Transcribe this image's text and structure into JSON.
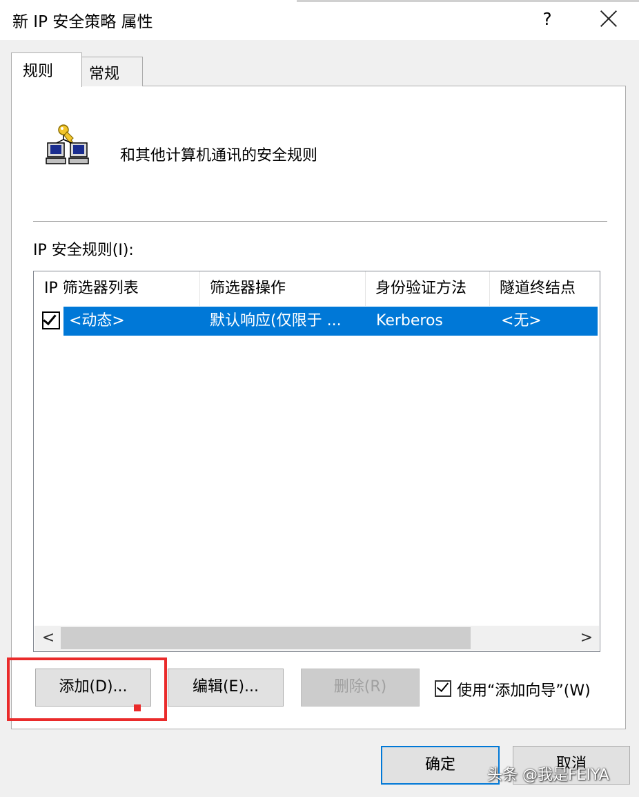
{
  "window": {
    "title": "新 IP 安全策略 属性",
    "help_glyph": "?",
    "close_icon": "close-icon"
  },
  "tabs": [
    {
      "label": "规则",
      "selected": true
    },
    {
      "label": "常规",
      "selected": false
    }
  ],
  "header": {
    "icon": "network-key-icon",
    "description": "和其他计算机通讯的安全规则"
  },
  "rules": {
    "label": "IP 安全规则(I):",
    "columns": [
      "IP 筛选器列表",
      "筛选器操作",
      "身份验证方法",
      "隧道终结点"
    ],
    "rows": [
      {
        "checked": true,
        "selected": true,
        "cells": [
          "<动态>",
          "默认响应(仅限于 ...",
          "Kerberos",
          "<无>"
        ]
      }
    ]
  },
  "scrollbar": {
    "left_arrow": "<",
    "right_arrow": ">"
  },
  "buttons": {
    "add": "添加(D)...",
    "edit": "编辑(E)...",
    "delete": "删除(R)",
    "delete_enabled": false
  },
  "wizard": {
    "label": "使用“添加向导”(W)",
    "checked": true
  },
  "footer": {
    "ok": "确定",
    "cancel": "取消"
  },
  "watermark": "头条 @我是FEIYA",
  "colors": {
    "selection": "#0078d7",
    "highlight": "#ea2b2b",
    "ok_border": "#0078d7"
  }
}
